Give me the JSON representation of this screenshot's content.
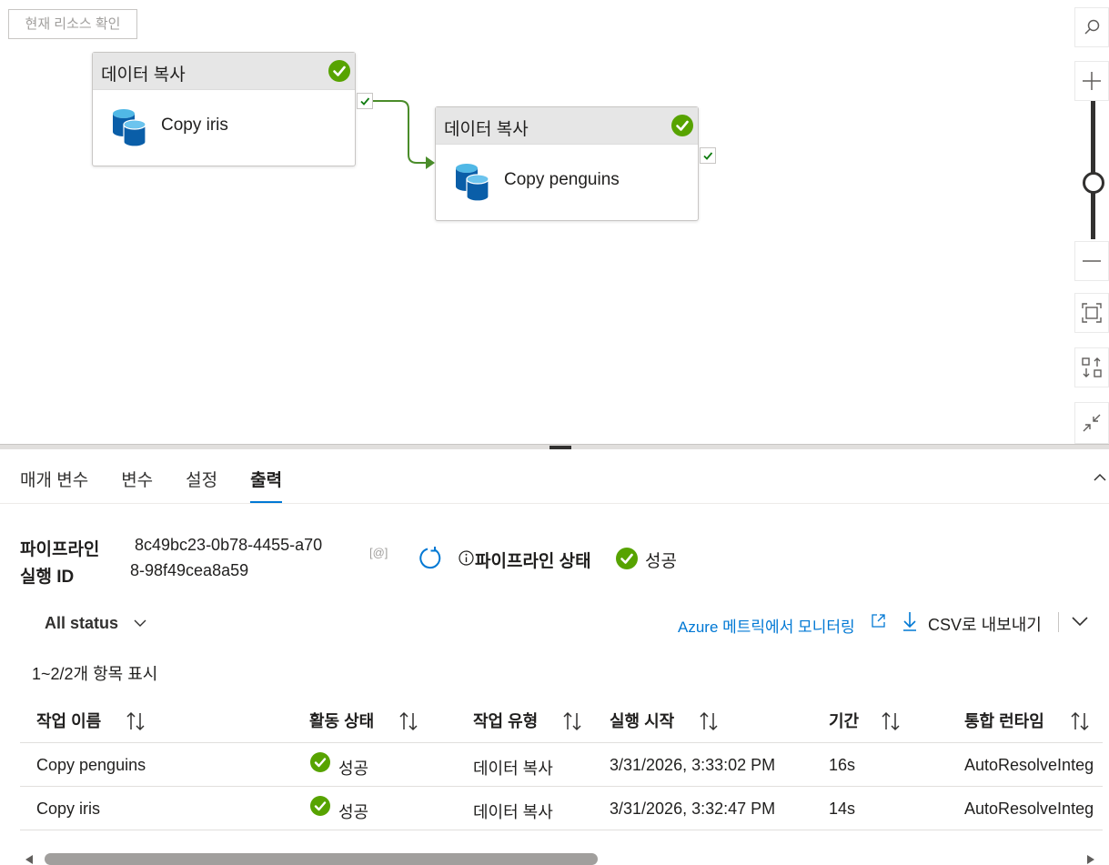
{
  "canvas": {
    "check_resource_label": "현재 리소스 확인",
    "activities": [
      {
        "type_label": "데이터 복사",
        "name": "Copy iris"
      },
      {
        "type_label": "데이터 복사",
        "name": "Copy penguins"
      }
    ],
    "zoom_level": 0.5
  },
  "tabs": [
    {
      "label": "매개 변수"
    },
    {
      "label": "변수"
    },
    {
      "label": "설정"
    },
    {
      "label": "출력",
      "active": true
    }
  ],
  "run": {
    "pipeline_run_label_line1": "파이프라인",
    "pipeline_run_label_line2": "실행 ID",
    "run_id_line1": "8c49bc23-0b78-4455-a70",
    "run_id_line2": "8-98f49cea8a59",
    "status_label": "파이프라인 상태",
    "status_value": "성공"
  },
  "filter": {
    "status_filter": "All status",
    "monitor_link": "Azure 메트릭에서 모니터링",
    "export_label": "CSV로 내보내기"
  },
  "table": {
    "count_label": "1~2/2개 항목 표시",
    "headers": [
      "작업 이름",
      "활동 상태",
      "작업 유형",
      "실행 시작",
      "기간",
      "통합 런타임"
    ],
    "rows": [
      {
        "name": "Copy penguins",
        "status": "성공",
        "type": "데이터 복사",
        "start": "3/31/2026, 3:33:02 PM",
        "duration": "16s",
        "runtime": "AutoResolveInteg"
      },
      {
        "name": "Copy iris",
        "status": "성공",
        "type": "데이터 복사",
        "start": "3/31/2026, 3:32:47 PM",
        "duration": "14s",
        "runtime": "AutoResolveInteg"
      }
    ]
  },
  "colors": {
    "accent": "#0078d4",
    "success": "#57a300"
  },
  "icons": [
    "search-icon",
    "zoom-in-icon",
    "zoom-out-icon",
    "fit-to-screen-icon",
    "auto-align-icon",
    "collapse-icon",
    "copy-icon",
    "refresh-icon",
    "info-icon",
    "external-link-icon",
    "download-icon",
    "chevron-down-icon",
    "chevron-up-icon",
    "database-icon",
    "success-check-icon"
  ]
}
